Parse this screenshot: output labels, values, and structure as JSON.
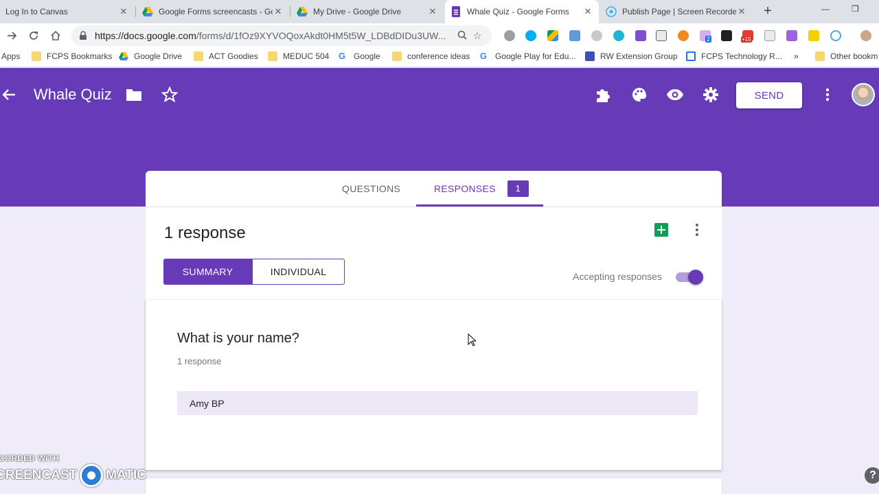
{
  "browser": {
    "tabs": [
      {
        "title": "Log In to Canvas",
        "icon": "canvas-icon"
      },
      {
        "title": "Google Forms screencasts - Go",
        "icon": "google-drive-icon"
      },
      {
        "title": "My Drive - Google Drive",
        "icon": "google-drive-icon"
      },
      {
        "title": "Whale Quiz - Google Forms",
        "icon": "google-forms-icon",
        "active": true
      },
      {
        "title": "Publish Page | Screen Recorde",
        "icon": "screencast-icon"
      }
    ],
    "url_host": "https://docs.google.com",
    "url_path": "/forms/d/1fOz9XYVOQoxAkdt0HM5t5W_LDBdDIDu3UW...",
    "extension_badges": {
      "badge_2": "2",
      "badge_15": "+15"
    },
    "bookmarks": [
      {
        "label": "Apps",
        "icon": "apps-icon"
      },
      {
        "label": "FCPS Bookmarks",
        "icon": "folder-icon"
      },
      {
        "label": "Google Drive",
        "icon": "google-drive-icon"
      },
      {
        "label": "ACT Goodies",
        "icon": "folder-icon"
      },
      {
        "label": "MEDUC 504",
        "icon": "folder-icon"
      },
      {
        "label": "Google",
        "icon": "google-icon"
      },
      {
        "label": "conference ideas",
        "icon": "folder-icon"
      },
      {
        "label": "Google Play for Edu...",
        "icon": "google-icon"
      },
      {
        "label": "RW Extension Group",
        "icon": "bookmark-page-icon"
      },
      {
        "label": "FCPS Technology R...",
        "icon": "bookmark-page-icon"
      },
      {
        "label": "Other bookm",
        "icon": "folder-icon"
      }
    ],
    "overflow": "»"
  },
  "forms": {
    "title": "Whale Quiz",
    "send_label": "SEND",
    "brand_color": "#673ab7",
    "tabs": {
      "questions": "QUESTIONS",
      "responses": "RESPONSES",
      "responses_count": "1"
    },
    "summary": {
      "response_count_text": "1 response",
      "summary_label": "SUMMARY",
      "individual_label": "INDIVIDUAL",
      "accepting_label": "Accepting responses",
      "accepting": true
    },
    "question": {
      "title": "What is your name?",
      "subtitle": "1 response",
      "answers": [
        "Amy BP"
      ]
    }
  },
  "watermark": {
    "line1": "CORDED WITH",
    "left": "CREENCAST",
    "right": "MATIC"
  },
  "help": "?"
}
